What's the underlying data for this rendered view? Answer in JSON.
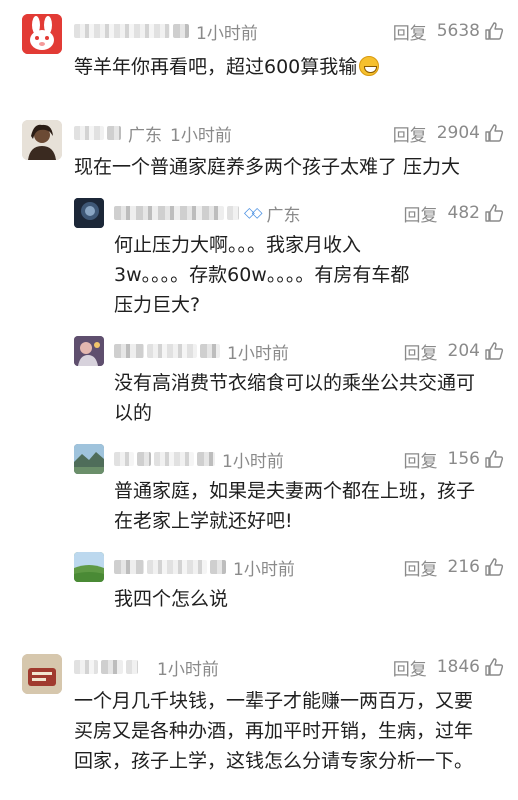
{
  "comments": [
    {
      "time": "1小时前",
      "reply": "回复",
      "likes": "5638",
      "text": [
        "等羊年你再看吧，超过600算我输"
      ],
      "avatar_icon": "rabbit-logo-icon"
    },
    {
      "region": "广东",
      "time": "1小时前",
      "reply": "回复",
      "likes": "2904",
      "text": [
        "现在一个普通家庭养多两个孩子太难了 压力大"
      ],
      "avatar_icon": "person-avatar"
    }
  ],
  "replies": [
    {
      "region": "广东",
      "reply": "回复",
      "likes": "482",
      "text": [
        "何止压力大啊。。。我家月收入",
        "3w。。。。存款60w。。。。有房有车都",
        "压力巨大?"
      ]
    },
    {
      "time": "1小时前",
      "reply": "回复",
      "likes": "204",
      "text": [
        "没有高消费节衣缩食可以的乘坐公共交通可",
        "以的"
      ]
    },
    {
      "time": "1小时前",
      "reply": "回复",
      "likes": "156",
      "text": [
        "普通家庭，如果是夫妻两个都在上班，孩子",
        "在老家上学就还好吧!"
      ]
    },
    {
      "time": "1小时前",
      "reply": "回复",
      "likes": "216",
      "text": [
        "我四个怎么说"
      ]
    }
  ],
  "last_comment": {
    "time": "1小时前",
    "reply": "回复",
    "likes": "1846",
    "text": [
      "一个月几千块钱，一辈子才能赚一两百万，又要",
      "买房又是各种办酒，再加平时开销，生病，过年",
      "回家，孩子上学，这钱怎么分请专家分析一下。"
    ]
  },
  "colors": {
    "meta_gray": "#8a8a8a",
    "text": "#1f1f1f",
    "vip_blue": "#4a90e2",
    "rabbit_red": "#e23b35"
  }
}
